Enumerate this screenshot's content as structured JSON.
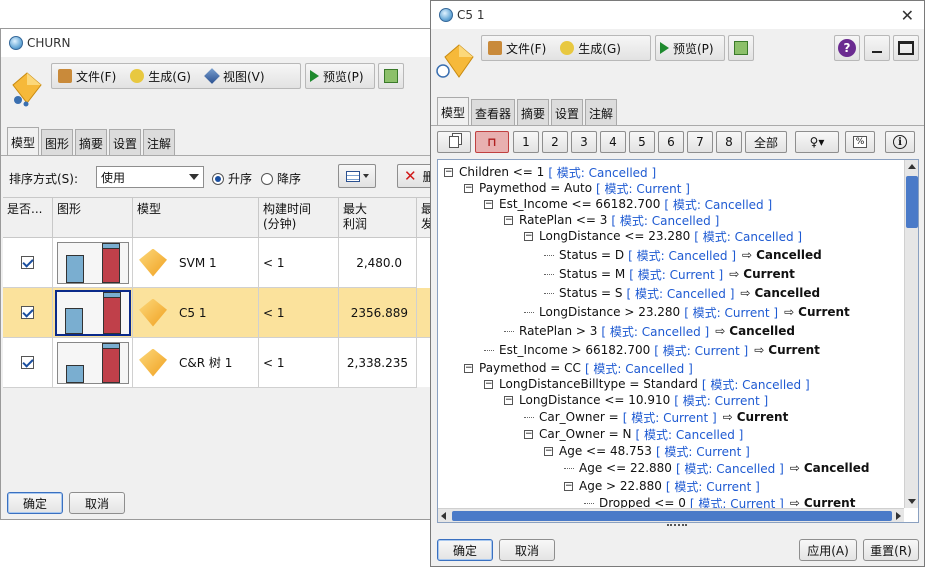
{
  "churn_window": {
    "title": "CHURN",
    "menu": [
      "文件(F)",
      "生成(G)",
      "视图(V)"
    ],
    "preview_label": "预览(P)",
    "tabs": [
      "模型",
      "图形",
      "摘要",
      "设置",
      "注解"
    ],
    "sort_label": "排序方式(S):",
    "sort_value": "使用",
    "sort_ascending": "升序",
    "sort_descending": "降序",
    "delete_label": "删",
    "columns": [
      "是否...",
      "图形",
      "模型",
      "构建时间\n(分钟)",
      "最大\n利润",
      "最\n发"
    ],
    "rows": [
      {
        "model": "SVM 1",
        "build_time": "< 1",
        "max_profit": "2,480.0",
        "checked": true
      },
      {
        "model": "C5 1",
        "build_time": "< 1",
        "max_profit": "2356.889",
        "checked": true
      },
      {
        "model": "C&R 树 1",
        "build_time": "< 1",
        "max_profit": "2,338.235",
        "checked": true
      }
    ],
    "ok_label": "确定",
    "cancel_label": "取消"
  },
  "c5_window": {
    "title": "C5 1",
    "menu": [
      "文件(F)",
      "生成(G)"
    ],
    "preview_label": "预览(P)",
    "tabs": [
      "模型",
      "查看器",
      "摘要",
      "设置",
      "注解"
    ],
    "depth_buttons": [
      "1",
      "2",
      "3",
      "4",
      "5",
      "6",
      "7",
      "8",
      "全部"
    ],
    "tree": [
      {
        "indent": 0,
        "exp": "−",
        "cond": "Children <= 1",
        "mode": "[ 模式: Cancelled ]",
        "result": ""
      },
      {
        "indent": 1,
        "exp": "−",
        "cond": "Paymethod = Auto",
        "mode": "[ 模式: Current ]",
        "result": ""
      },
      {
        "indent": 2,
        "exp": "−",
        "cond": "Est_Income <= 66182.700",
        "mode": "[ 模式: Cancelled ]",
        "result": ""
      },
      {
        "indent": 3,
        "exp": "−",
        "cond": "RatePlan <= 3",
        "mode": "[ 模式: Cancelled ]",
        "result": ""
      },
      {
        "indent": 4,
        "exp": "−",
        "cond": "LongDistance <= 23.280",
        "mode": "[ 模式: Cancelled ]",
        "result": ""
      },
      {
        "indent": 5,
        "exp": "",
        "cond": "Status = D",
        "mode": "[ 模式: Cancelled ]",
        "result": "Cancelled"
      },
      {
        "indent": 5,
        "exp": "",
        "cond": "Status = M",
        "mode": "[ 模式: Current ]",
        "result": "Current"
      },
      {
        "indent": 5,
        "exp": "",
        "cond": "Status = S",
        "mode": "[ 模式: Cancelled ]",
        "result": "Cancelled"
      },
      {
        "indent": 4,
        "exp": "",
        "cond": "LongDistance > 23.280",
        "mode": "[ 模式: Current ]",
        "result": "Current"
      },
      {
        "indent": 3,
        "exp": "",
        "cond": "RatePlan > 3",
        "mode": "[ 模式: Cancelled ]",
        "result": "Cancelled"
      },
      {
        "indent": 2,
        "exp": "",
        "cond": "Est_Income > 66182.700",
        "mode": "[ 模式: Current ]",
        "result": "Current"
      },
      {
        "indent": 1,
        "exp": "−",
        "cond": "Paymethod = CC",
        "mode": "[ 模式: Cancelled ]",
        "result": ""
      },
      {
        "indent": 2,
        "exp": "−",
        "cond": "LongDistanceBilltype = Standard",
        "mode": "[ 模式: Cancelled ]",
        "result": ""
      },
      {
        "indent": 3,
        "exp": "−",
        "cond": "LongDistance <= 10.910",
        "mode": "[ 模式: Current ]",
        "result": ""
      },
      {
        "indent": 4,
        "exp": "",
        "cond": "Car_Owner =",
        "mode": "[ 模式: Current ]",
        "result": "Current"
      },
      {
        "indent": 4,
        "exp": "−",
        "cond": "Car_Owner = N",
        "mode": "[ 模式: Cancelled ]",
        "result": ""
      },
      {
        "indent": 5,
        "exp": "−",
        "cond": "Age <= 48.753",
        "mode": "[ 模式: Current ]",
        "result": ""
      },
      {
        "indent": 6,
        "exp": "",
        "cond": "Age <= 22.880",
        "mode": "[ 模式: Cancelled ]",
        "result": "Cancelled"
      },
      {
        "indent": 6,
        "exp": "−",
        "cond": "Age > 22.880",
        "mode": "[ 模式: Current ]",
        "result": ""
      },
      {
        "indent": 7,
        "exp": "",
        "cond": "Dropped <= 0",
        "mode": "[ 模式: Current ]",
        "result": "Current"
      }
    ],
    "ok_label": "确定",
    "cancel_label": "取消",
    "apply_label": "应用(A)",
    "reset_label": "重置(R)",
    "help_label": "?",
    "pct_label": "%",
    "info_label": "i"
  },
  "colors": {
    "highlight_row": "#fbe29c",
    "bar_red": "#c0404a",
    "bar_blue": "#7aaed0",
    "link_blue": "#1e5ad2"
  }
}
